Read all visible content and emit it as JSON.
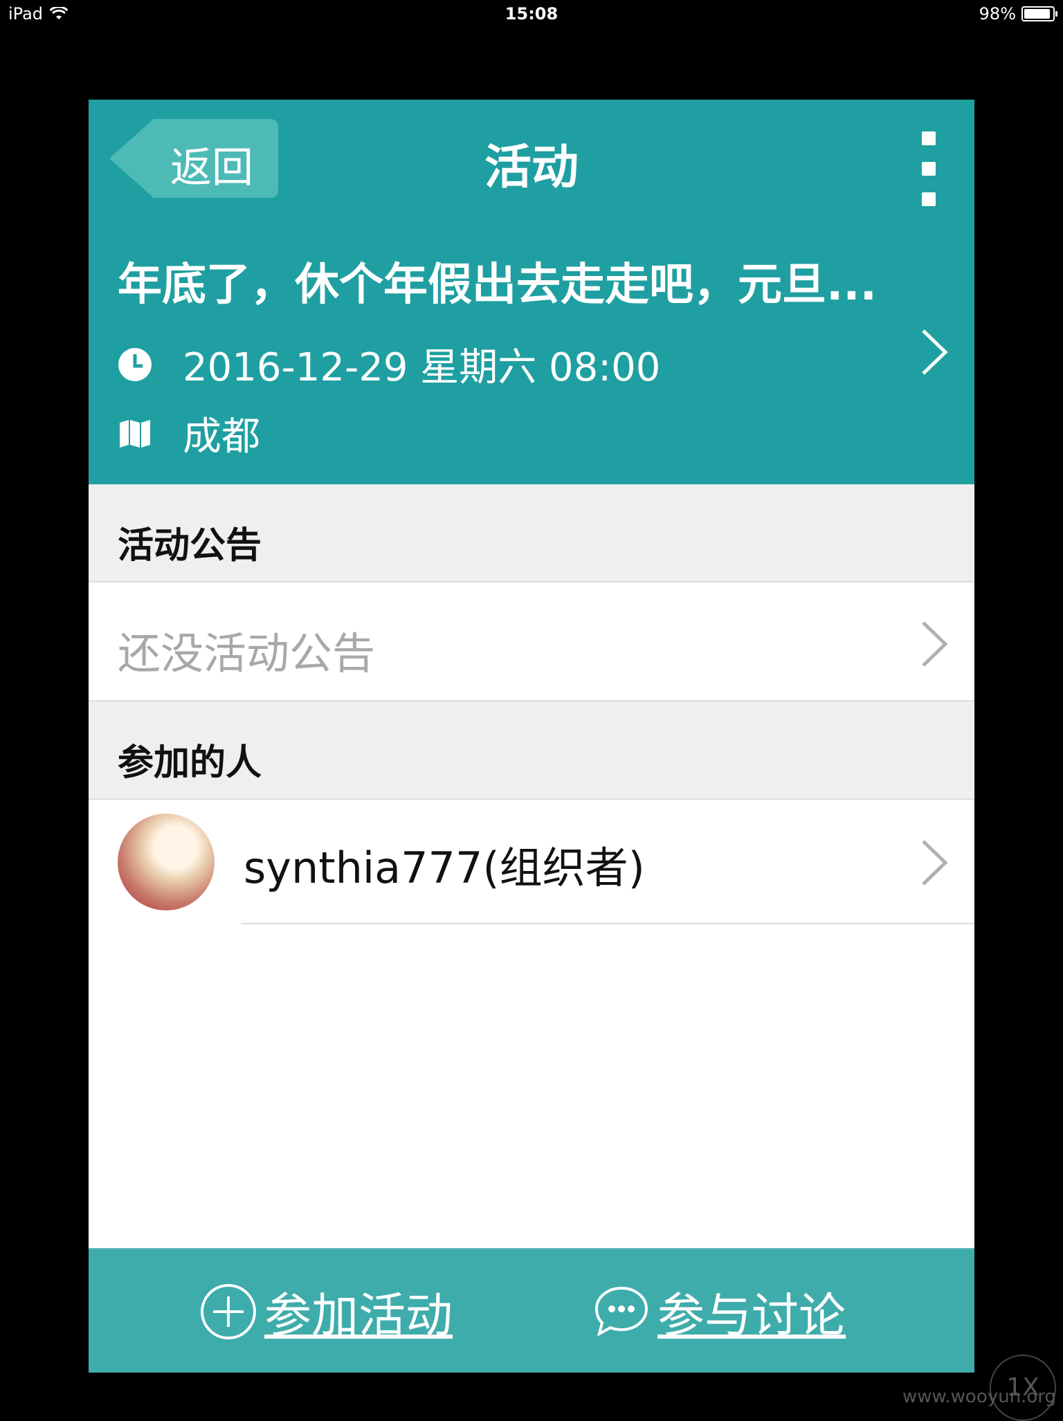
{
  "status_bar": {
    "device": "iPad",
    "time": "15:08",
    "battery": "98%",
    "battery_level": 0.98
  },
  "nav": {
    "back_label": "返回",
    "title": "活动"
  },
  "event": {
    "title": "年底了，休个年假出去走走吧，元旦...",
    "datetime": "2016-12-29 星期六 08:00",
    "location": "成都"
  },
  "announcement": {
    "section_title": "活动公告",
    "empty_text": "还没活动公告"
  },
  "participants": {
    "section_title": "参加的人",
    "items": [
      {
        "name": "synthia777(组织者)"
      }
    ]
  },
  "actions": {
    "join_label": "参加活动",
    "discuss_label": "参与讨论"
  },
  "watermark": {
    "badge": "1X",
    "url": "www.wooyun.org"
  },
  "colors": {
    "header": "#1f9fa1",
    "bottom_bar": "#3eacab",
    "section_bg": "#efefef"
  }
}
